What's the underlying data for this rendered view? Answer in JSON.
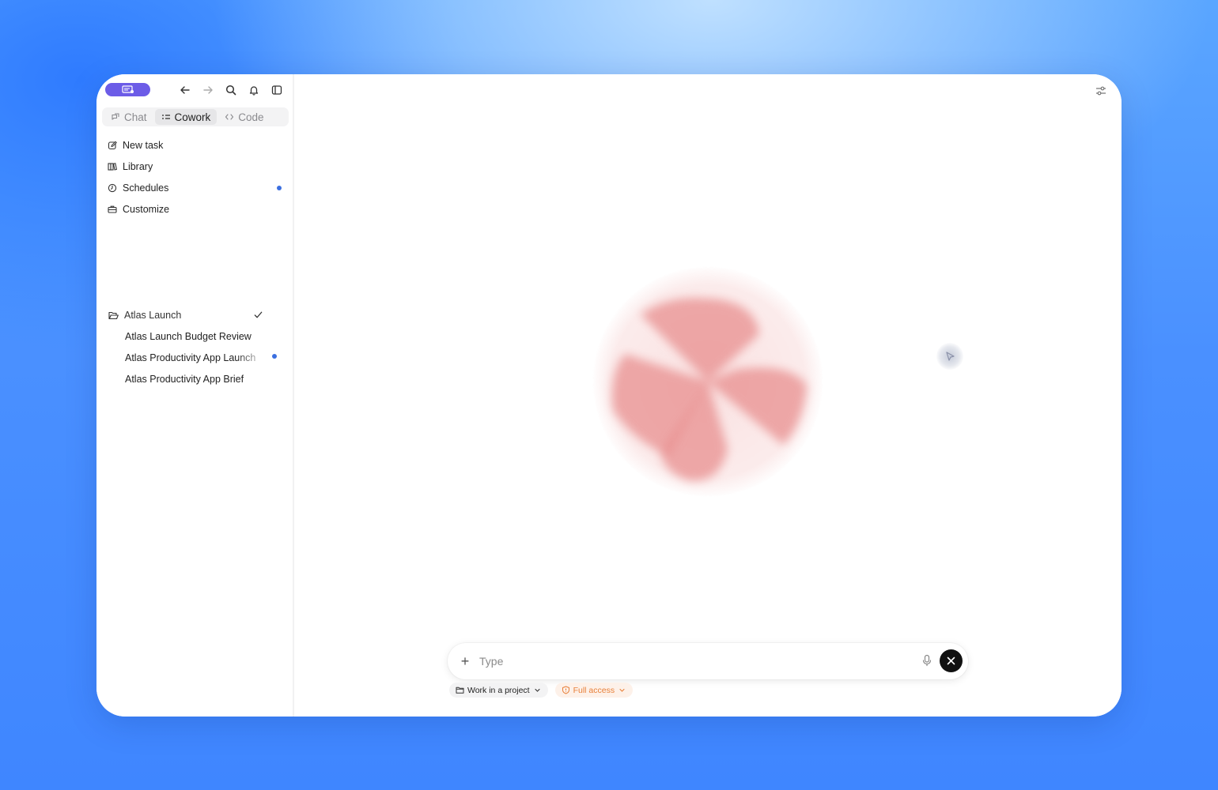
{
  "sidebar": {
    "mode_tabs": [
      {
        "label": "Chat",
        "icon": "chat-icon",
        "active": false
      },
      {
        "label": "Cowork",
        "icon": "cowork-icon",
        "active": true
      },
      {
        "label": "Code",
        "icon": "code-icon",
        "active": false
      }
    ],
    "nav": {
      "new_task": "New task",
      "library": "Library",
      "schedules": "Schedules",
      "customize": "Customize"
    },
    "project": {
      "name": "Atlas Launch",
      "items": [
        "Atlas Launch Budget Review",
        "Atlas Productivity App Launch",
        "Atlas Productivity App Brief"
      ]
    }
  },
  "composer": {
    "placeholder": "Type",
    "project_chip": "Work in a project",
    "access_chip": "Full access"
  },
  "colors": {
    "brand": "#6c5ce7",
    "unread_dot": "#3b6fe0",
    "access_accent": "#e8803a",
    "orb": "#e88f8f"
  }
}
